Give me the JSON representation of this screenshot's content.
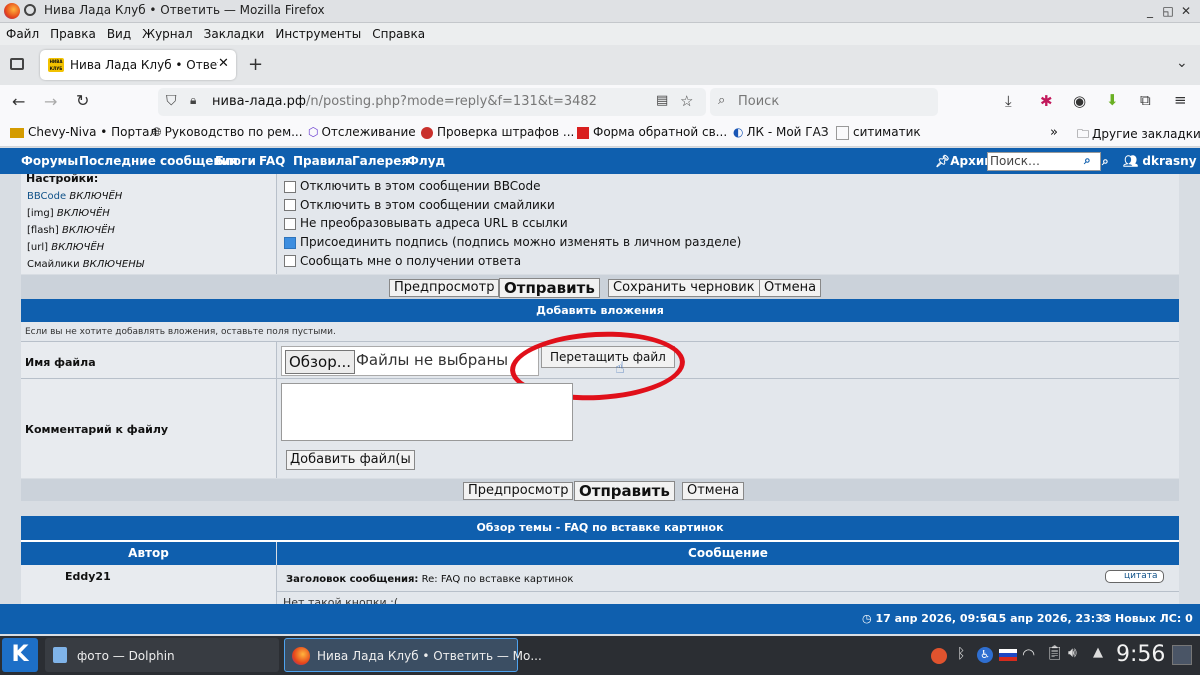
{
  "window": {
    "title": "Нива Лада Клуб • Ответить — Mozilla Firefox"
  },
  "menubar": {
    "items": [
      "Файл",
      "Правка",
      "Вид",
      "Журнал",
      "Закладки",
      "Инструменты",
      "Справка"
    ]
  },
  "tab": {
    "label": "Нива Лада Клуб • Ответит",
    "logo_text": "НИВА КЛУБ"
  },
  "navbar": {
    "url_host": "нива-лада.рф",
    "url_path": "/n/posting.php?mode=reply&f=131&t=3482",
    "search_placeholder": "Поиск"
  },
  "bookmarks": {
    "items": [
      "Chevy-Niva • Портал",
      "Руководство по рем...",
      "Отслеживание",
      "Проверка штрафов ...",
      "Форма обратной св...",
      "ЛК - Мой ГАЗ",
      "ситиматик"
    ],
    "more_label": "Другие закладки"
  },
  "forumnav": {
    "items": [
      "Форумы",
      "Последние сообщения",
      "Блоги",
      "FAQ",
      "Правила",
      "Галерея",
      "Флуд"
    ],
    "archive": "Архив",
    "search_placeholder": "Поиск…",
    "user": "dkrasny"
  },
  "settings": {
    "title": "Настройки:",
    "info": [
      {
        "link": "BBCode",
        "state": "ВКЛЮЧЁН"
      },
      {
        "link": "[img]",
        "state": "ВКЛЮЧЁН"
      },
      {
        "link": "[flash]",
        "state": "ВКЛЮЧЁН"
      },
      {
        "link": "[url]",
        "state": "ВКЛЮЧЁН"
      },
      {
        "link": "Смайлики",
        "state": "ВКЛЮЧЕНЫ"
      }
    ],
    "options": [
      {
        "label": "Отключить в этом сообщении BBCode",
        "checked": false
      },
      {
        "label": "Отключить в этом сообщении смайлики",
        "checked": false
      },
      {
        "label": "Не преобразовывать адреса URL в ссылки",
        "checked": false
      },
      {
        "label": "Присоединить подпись (подпись можно изменять в личном разделе)",
        "checked": true
      },
      {
        "label": "Сообщать мне о получении ответа",
        "checked": false
      }
    ]
  },
  "buttons": {
    "preview": "Предпросмотр",
    "submit": "Отправить",
    "save_draft": "Сохранить черновик",
    "cancel": "Отмена"
  },
  "attachments": {
    "header": "Добавить вложения",
    "hint": "Если вы не хотите добавлять вложения, оставьте поля пустыми.",
    "filename_label": "Имя файла",
    "browse_label": "Обзор...",
    "no_files": "Файлы не выбраны",
    "drag_label": "Перетащить файл",
    "comment_label": "Комментарий к файлу",
    "add_file_label": "Добавить файл(ы"
  },
  "topic_review": {
    "header": "Обзор темы - FAQ по вставке картинок",
    "col_author": "Автор",
    "col_message": "Сообщение",
    "post_author": "Eddy21",
    "subject_label": "Заголовок сообщения:",
    "subject_value": "Re: FAQ по вставке картинок",
    "quote_label": "цитата",
    "body_partial": "Нет такой кнопки :("
  },
  "forumstatus": {
    "time1": "17 апр 2026, 09:56",
    "time2": "15 апр 2026, 23:33",
    "new_pm": "Новых ЛС: 0"
  },
  "taskbar": {
    "tasks": [
      "фото — Dolphin",
      "Нива Лада Клуб • Ответить — Мо..."
    ],
    "clock": "9:56"
  },
  "colors": {
    "accent": "#0f5fae",
    "annotation": "#e0101a"
  }
}
